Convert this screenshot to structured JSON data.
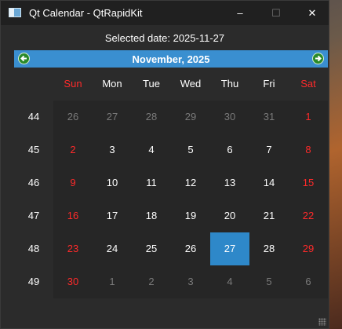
{
  "window": {
    "title": "Qt Calendar - QtRapidKit",
    "minimize_glyph": "–",
    "maximize_glyph": "☐",
    "close_glyph": "✕"
  },
  "selected_text": "Selected date: 2025-11-27",
  "navigation": {
    "month_year": "November,  2025",
    "prev_icon": "left-arrow-icon",
    "next_icon": "right-arrow-icon"
  },
  "weekdays": [
    "Sun",
    "Mon",
    "Tue",
    "Wed",
    "Thu",
    "Fri",
    "Sat"
  ],
  "weeks": [
    {
      "week": "44",
      "days": [
        {
          "d": "26",
          "other": true
        },
        {
          "d": "27",
          "other": true
        },
        {
          "d": "28",
          "other": true
        },
        {
          "d": "29",
          "other": true
        },
        {
          "d": "30",
          "other": true
        },
        {
          "d": "31",
          "other": true
        },
        {
          "d": "1"
        }
      ]
    },
    {
      "week": "45",
      "days": [
        {
          "d": "2"
        },
        {
          "d": "3"
        },
        {
          "d": "4"
        },
        {
          "d": "5"
        },
        {
          "d": "6"
        },
        {
          "d": "7"
        },
        {
          "d": "8"
        }
      ]
    },
    {
      "week": "46",
      "days": [
        {
          "d": "9"
        },
        {
          "d": "10"
        },
        {
          "d": "11"
        },
        {
          "d": "12"
        },
        {
          "d": "13"
        },
        {
          "d": "14"
        },
        {
          "d": "15"
        }
      ]
    },
    {
      "week": "47",
      "days": [
        {
          "d": "16"
        },
        {
          "d": "17"
        },
        {
          "d": "18"
        },
        {
          "d": "19"
        },
        {
          "d": "20"
        },
        {
          "d": "21"
        },
        {
          "d": "22"
        }
      ]
    },
    {
      "week": "48",
      "days": [
        {
          "d": "23"
        },
        {
          "d": "24"
        },
        {
          "d": "25"
        },
        {
          "d": "26"
        },
        {
          "d": "27",
          "selected": true
        },
        {
          "d": "28"
        },
        {
          "d": "29"
        }
      ]
    },
    {
      "week": "49",
      "days": [
        {
          "d": "30"
        },
        {
          "d": "1",
          "other": true
        },
        {
          "d": "2",
          "other": true
        },
        {
          "d": "3",
          "other": true
        },
        {
          "d": "4",
          "other": true
        },
        {
          "d": "5",
          "other": true
        },
        {
          "d": "6",
          "other": true
        }
      ]
    }
  ],
  "colors": {
    "weekend": "#ff2a2a",
    "selected_bg": "#2e88c9",
    "nav_bg": "#3a8fd0",
    "other_month": "#7a7a7a"
  }
}
